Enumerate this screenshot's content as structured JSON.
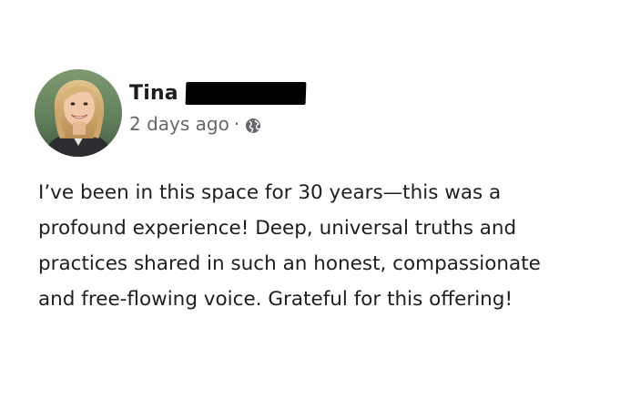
{
  "post": {
    "author_first_name": "Tina",
    "author_last_name_redacted": true,
    "timestamp": "2 days ago",
    "separator": "·",
    "audience_icon": "globe-icon",
    "body_lines": [
      "I’ve been in this space for 30 years—this was a",
      "profound experience! Deep, universal truths and",
      "practices shared in such an honest, compassionate",
      "and free-flowing voice. Grateful for this offering!"
    ]
  },
  "colors": {
    "text_primary": "#1c1e21",
    "text_secondary": "#65676b",
    "redaction": "#000000",
    "background": "#ffffff"
  }
}
